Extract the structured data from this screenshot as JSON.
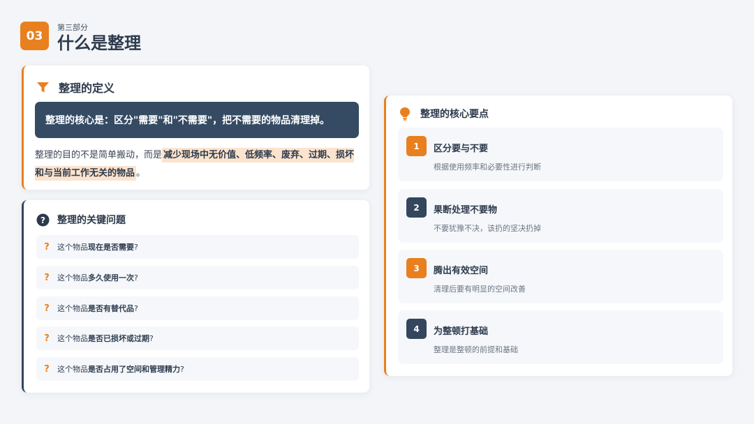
{
  "header": {
    "badge": "03",
    "kicker": "第三部分",
    "title": "什么是整理"
  },
  "definition": {
    "title": "整理的定义",
    "icon": "filter-icon",
    "highlight": "整理的核心是：区分\"需要\"和\"不需要\"，把不需要的物品清理掉。",
    "para_prefix": "整理的目的不是简单搬动，而是",
    "para_mark": "减少现场中无价值、低频率、废弃、过期、损坏和与当前工作无关的物品",
    "para_suffix": "。"
  },
  "questions": {
    "title": "整理的关键问题",
    "icon": "question-circle-icon",
    "items": [
      {
        "mark": "?",
        "prefix": "这个物品",
        "bold": "现在是否需要",
        "suffix": "?"
      },
      {
        "mark": "?",
        "prefix": "这个物品",
        "bold": "多久使用一次",
        "suffix": "?"
      },
      {
        "mark": "?",
        "prefix": "这个物品",
        "bold": "是否有替代品",
        "suffix": "?"
      },
      {
        "mark": "?",
        "prefix": "这个物品",
        "bold": "是否已损坏或过期",
        "suffix": "?"
      },
      {
        "mark": "?",
        "prefix": "这个物品",
        "bold": "是否占用了空间和管理精力",
        "suffix": "?"
      }
    ]
  },
  "points": {
    "title": "整理的核心要点",
    "icon": "lightbulb-icon",
    "items": [
      {
        "num": "1",
        "title": "区分要与不要",
        "desc": "根据使用频率和必要性进行判断",
        "color": "#e8801f"
      },
      {
        "num": "2",
        "title": "果断处理不要物",
        "desc": "不要犹豫不决，该扔的坚决扔掉",
        "color": "#34465d"
      },
      {
        "num": "3",
        "title": "腾出有效空间",
        "desc": "清理后要有明显的空间改善",
        "color": "#e8801f"
      },
      {
        "num": "4",
        "title": "为整顿打基础",
        "desc": "整理是整顿的前提和基础",
        "color": "#34465d"
      }
    ]
  },
  "colors": {
    "accent": "#e8801f",
    "navy": "#34465d",
    "background": "#f3f5f8"
  }
}
